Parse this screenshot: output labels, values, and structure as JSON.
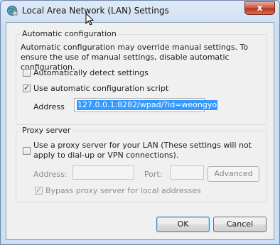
{
  "window": {
    "title": "Local Area Network (LAN) Settings",
    "close_glyph": "x"
  },
  "auto_config": {
    "legend": "Automatic configuration",
    "description": "Automatic configuration may override manual settings.  To ensure the use of manual settings, disable automatic configuration.",
    "detect_label": "Automatically detect settings",
    "detect_checked": false,
    "script_label": "Use automatic configuration script",
    "script_checked": true,
    "address_label": "Address",
    "address_value": "127.0.0.1:8282/wpad/?id=weongyo"
  },
  "proxy": {
    "legend": "Proxy server",
    "use_proxy_label": "Use a proxy server for your LAN (These settings will not apply to dial-up or VPN connections).",
    "use_proxy_checked": false,
    "address_label": "Address:",
    "port_label": "Port:",
    "advanced_label": "Advanced",
    "bypass_label": "Bypass proxy server for local addresses",
    "bypass_checked": true
  },
  "buttons": {
    "ok": "OK",
    "cancel": "Cancel"
  },
  "icons": {
    "title": "network-globe-icon",
    "close": "close-icon"
  }
}
